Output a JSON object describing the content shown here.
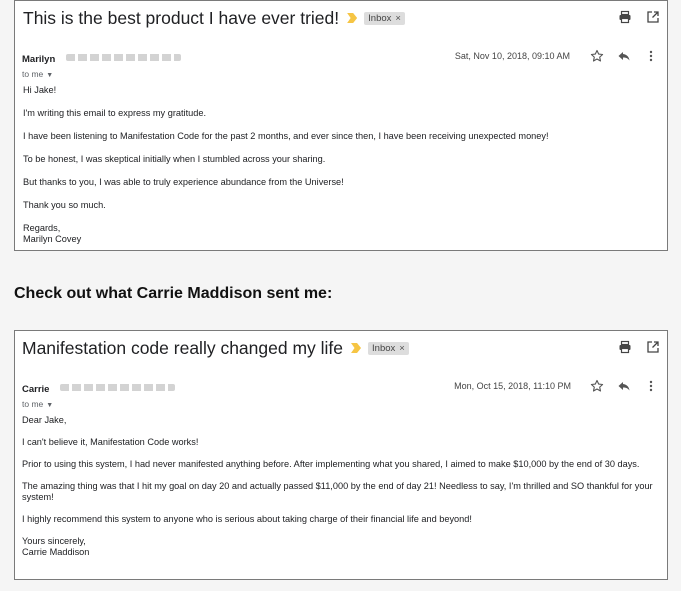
{
  "email1": {
    "subject": "This is the best product I have ever tried!",
    "label": "Inbox",
    "label_close": "×",
    "sender": "Marilyn",
    "date": "Sat, Nov 10, 2018, 09:10 AM",
    "to": "to me",
    "greeting": "Hi Jake!",
    "paragraphs": [
      "I'm writing this email to express my gratitude.",
      "I have been listening to Manifestation Code for the past 2 months, and ever since then, I have been receiving unexpected money!",
      "To be honest, I was skeptical initially when I stumbled across your sharing.",
      "But thanks to you, I was able to truly experience abundance from the Universe!",
      "Thank you so much."
    ],
    "closing": "Regards,",
    "signature": "Marilyn Covey"
  },
  "heading": "Check out what Carrie Maddison sent me:",
  "email2": {
    "subject": "Manifestation code really changed my life",
    "label": "Inbox",
    "label_close": "×",
    "sender": "Carrie",
    "date": "Mon, Oct 15, 2018, 11:10 PM",
    "to": "to me",
    "greeting": "Dear Jake,",
    "paragraphs": [
      "I can't believe it, Manifestation Code works!",
      "Prior to using this system, I had never manifested anything before. After implementing what you shared, I aimed to make $10,000 by the end of 30 days.",
      "The amazing thing was that I hit my goal on day 20 and actually passed $11,000 by the end of day 21! Needless to say, I'm thrilled and SO thankful for your system!",
      "I highly recommend this system to anyone who is serious about taking charge of their financial life and beyond!"
    ],
    "closing": "Yours sincerely,",
    "signature": "Carrie Maddison"
  },
  "icons": {
    "print": "print-icon",
    "open_new": "open-in-new-window-icon",
    "star": "star-icon",
    "reply": "reply-icon",
    "more": "more-options-icon",
    "importance": "importance-marker-icon"
  },
  "colors": {
    "importance": "#f6c544",
    "label_bg": "#dddddd",
    "card_border": "#7a7a7a"
  }
}
